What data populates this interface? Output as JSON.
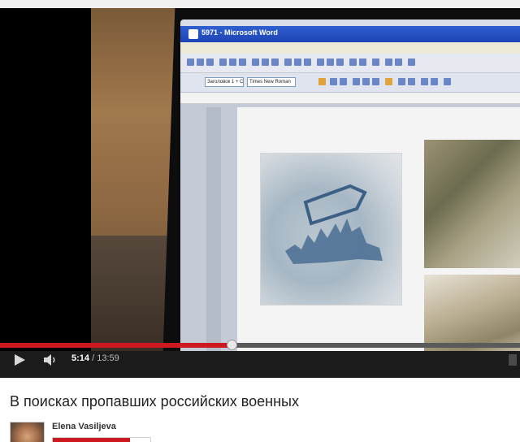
{
  "video": {
    "title": "В поисках пропавших российских военных",
    "current_time": "5:14",
    "separator": " / ",
    "duration": "13:59",
    "progress_fraction": 0.446
  },
  "screen_content": {
    "window_title": "5971 - Microsoft Word",
    "font_box": "Times New Roman",
    "style_box": "Заголовок 1 + С"
  },
  "channel": {
    "name": "Elena Vasiljeva"
  },
  "icons": {
    "play": "play-icon",
    "volume": "volume-icon"
  },
  "colors": {
    "progress": "#cc181e",
    "controls_bg": "#1b1b1b",
    "subscribe_red": "#cc181e"
  }
}
